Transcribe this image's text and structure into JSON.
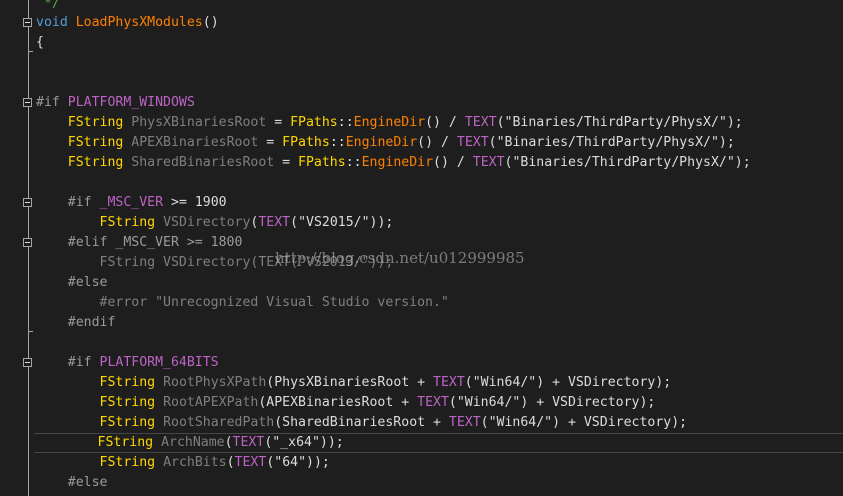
{
  "editor": {
    "top_comment": "*/",
    "lines": [
      {
        "tokens": [
          {
            "t": "void",
            "c": "kw"
          },
          {
            "t": " "
          },
          {
            "t": "LoadPhysXModules",
            "c": "fn"
          },
          {
            "t": "()"
          }
        ]
      },
      {
        "tokens": [
          {
            "t": "{"
          }
        ]
      },
      {
        "tokens": []
      },
      {
        "tokens": []
      },
      {
        "tokens": [
          {
            "t": "#if ",
            "c": "pp"
          },
          {
            "t": "PLATFORM_WINDOWS",
            "c": "mac"
          }
        ]
      },
      {
        "tokens": [
          {
            "t": "    "
          },
          {
            "t": "FString",
            "c": "ty"
          },
          {
            "t": " "
          },
          {
            "t": "PhysXBinariesRoot",
            "c": "gray"
          },
          {
            "t": " = "
          },
          {
            "t": "FPaths",
            "c": "cls"
          },
          {
            "t": "::"
          },
          {
            "t": "EngineDir",
            "c": "fn"
          },
          {
            "t": "() / "
          },
          {
            "t": "TEXT",
            "c": "mac"
          },
          {
            "t": "(\"Binaries/ThirdParty/PhysX/\");"
          }
        ]
      },
      {
        "tokens": [
          {
            "t": "    "
          },
          {
            "t": "FString",
            "c": "ty"
          },
          {
            "t": " "
          },
          {
            "t": "APEXBinariesRoot",
            "c": "gray"
          },
          {
            "t": " = "
          },
          {
            "t": "FPaths",
            "c": "cls"
          },
          {
            "t": "::"
          },
          {
            "t": "EngineDir",
            "c": "fn"
          },
          {
            "t": "() / "
          },
          {
            "t": "TEXT",
            "c": "mac"
          },
          {
            "t": "(\"Binaries/ThirdParty/PhysX/\");"
          }
        ]
      },
      {
        "tokens": [
          {
            "t": "    "
          },
          {
            "t": "FString",
            "c": "ty"
          },
          {
            "t": " "
          },
          {
            "t": "SharedBinariesRoot",
            "c": "gray"
          },
          {
            "t": " = "
          },
          {
            "t": "FPaths",
            "c": "cls"
          },
          {
            "t": "::"
          },
          {
            "t": "EngineDir",
            "c": "fn"
          },
          {
            "t": "() / "
          },
          {
            "t": "TEXT",
            "c": "mac"
          },
          {
            "t": "(\"Binaries/ThirdParty/PhysX/\");"
          }
        ]
      },
      {
        "tokens": []
      },
      {
        "tokens": [
          {
            "t": "    "
          },
          {
            "t": "#if ",
            "c": "pp"
          },
          {
            "t": "_MSC_VER",
            "c": "mac"
          },
          {
            "t": " >= 1900"
          }
        ]
      },
      {
        "tokens": [
          {
            "t": "        "
          },
          {
            "t": "FString",
            "c": "ty"
          },
          {
            "t": " "
          },
          {
            "t": "VSDirectory",
            "c": "gray"
          },
          {
            "t": "("
          },
          {
            "t": "TEXT",
            "c": "mac"
          },
          {
            "t": "(\"VS2015/\"));"
          }
        ]
      },
      {
        "tokens": [
          {
            "t": "    "
          },
          {
            "t": "#elif ",
            "c": "pp"
          },
          {
            "t": "_MSC_VER >= 1800",
            "c": "pp"
          }
        ]
      },
      {
        "tokens": [
          {
            "t": "        "
          },
          {
            "t": "FString VSDirectory(TEXT(\"VS2013/\"));",
            "c": "gray"
          }
        ]
      },
      {
        "tokens": [
          {
            "t": "    "
          },
          {
            "t": "#else",
            "c": "pp"
          }
        ]
      },
      {
        "tokens": [
          {
            "t": "        "
          },
          {
            "t": "#error \"Unrecognized Visual Studio version.\"",
            "c": "gray"
          }
        ]
      },
      {
        "tokens": [
          {
            "t": "    "
          },
          {
            "t": "#endif",
            "c": "pp"
          }
        ]
      },
      {
        "tokens": []
      },
      {
        "tokens": [
          {
            "t": "    "
          },
          {
            "t": "#if ",
            "c": "pp"
          },
          {
            "t": "PLATFORM_64BITS",
            "c": "mac"
          }
        ]
      },
      {
        "tokens": [
          {
            "t": "        "
          },
          {
            "t": "FString",
            "c": "ty"
          },
          {
            "t": " "
          },
          {
            "t": "RootPhysXPath",
            "c": "gray"
          },
          {
            "t": "(PhysXBinariesRoot + "
          },
          {
            "t": "TEXT",
            "c": "mac"
          },
          {
            "t": "(\"Win64/\") + VSDirectory);"
          }
        ]
      },
      {
        "tokens": [
          {
            "t": "        "
          },
          {
            "t": "FString",
            "c": "ty"
          },
          {
            "t": " "
          },
          {
            "t": "RootAPEXPath",
            "c": "gray"
          },
          {
            "t": "(APEXBinariesRoot + "
          },
          {
            "t": "TEXT",
            "c": "mac"
          },
          {
            "t": "(\"Win64/\") + VSDirectory);"
          }
        ]
      },
      {
        "tokens": [
          {
            "t": "        "
          },
          {
            "t": "FString",
            "c": "ty"
          },
          {
            "t": " "
          },
          {
            "t": "RootSharedPath",
            "c": "gray"
          },
          {
            "t": "(SharedBinariesRoot + "
          },
          {
            "t": "TEXT",
            "c": "mac"
          },
          {
            "t": "(\"Win64/\") + VSDirectory);"
          }
        ]
      },
      {
        "tokens": [
          {
            "t": "        "
          },
          {
            "t": "FString",
            "c": "ty"
          },
          {
            "t": " "
          },
          {
            "t": "ArchName",
            "c": "gray"
          },
          {
            "t": "("
          },
          {
            "t": "TEXT",
            "c": "mac"
          },
          {
            "t": "(\"_x64\"));"
          }
        ]
      },
      {
        "tokens": [
          {
            "t": "        "
          },
          {
            "t": "FString",
            "c": "ty"
          },
          {
            "t": " "
          },
          {
            "t": "ArchBits",
            "c": "gray"
          },
          {
            "t": "("
          },
          {
            "t": "TEXT",
            "c": "mac"
          },
          {
            "t": "(\"64\"));"
          }
        ]
      },
      {
        "tokens": [
          {
            "t": "    "
          },
          {
            "t": "#else",
            "c": "pp"
          }
        ]
      }
    ],
    "watermark": "http://blog.csdn.net/u012999985",
    "colors": {
      "background": "#1e1e1e",
      "keyword": "#569cd6",
      "type": "#ffd700",
      "function": "#ff8000",
      "macro": "#bd63c5",
      "string": "#d69d85"
    }
  }
}
